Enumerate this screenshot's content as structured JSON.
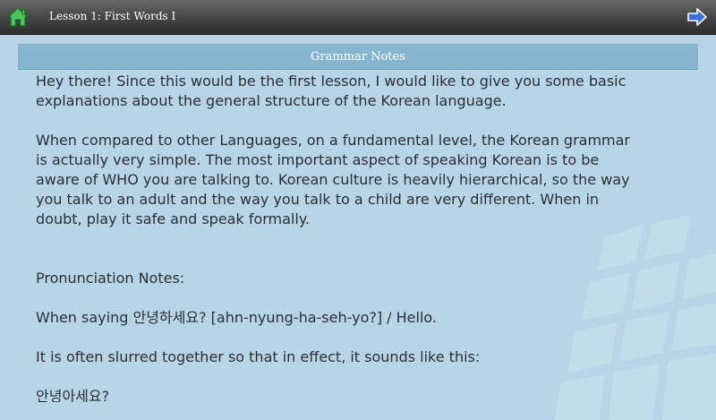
{
  "header": {
    "title": "Lesson 1: First Words I",
    "home_icon": "home-icon",
    "next_icon": "arrow-right-icon",
    "home_color": "#3bb34a",
    "next_color": "#2f5fc7"
  },
  "section": {
    "title": "Grammar Notes"
  },
  "content": {
    "intro_line1": "Hey there! Since this would be the first lesson, I would like to give you some basic",
    "intro_line2": "explanations about the general structure of the Korean language.",
    "grammar_line1": "When compared to other Languages, on a fundamental level, the Korean grammar",
    "grammar_line2": "is actually very simple.  The most important aspect of speaking Korean is to be",
    "grammar_line3": "aware of WHO you are talking to.  Korean culture is heavily hierarchical, so the way",
    "grammar_line4": "you talk to an adult and the way you talk to a child are very different.  When in",
    "grammar_line5": "doubt, play it safe and speak formally.",
    "pronunciation_heading": "Pronunciation Notes:",
    "saying_line": "When saying 안녕하세요? [ahn-nyung-ha-seh-yo?] / Hello.",
    "slurred_line": "It is often slurred together so that in effect, it sounds like this:",
    "slurred_example": "안녕아세요?"
  }
}
